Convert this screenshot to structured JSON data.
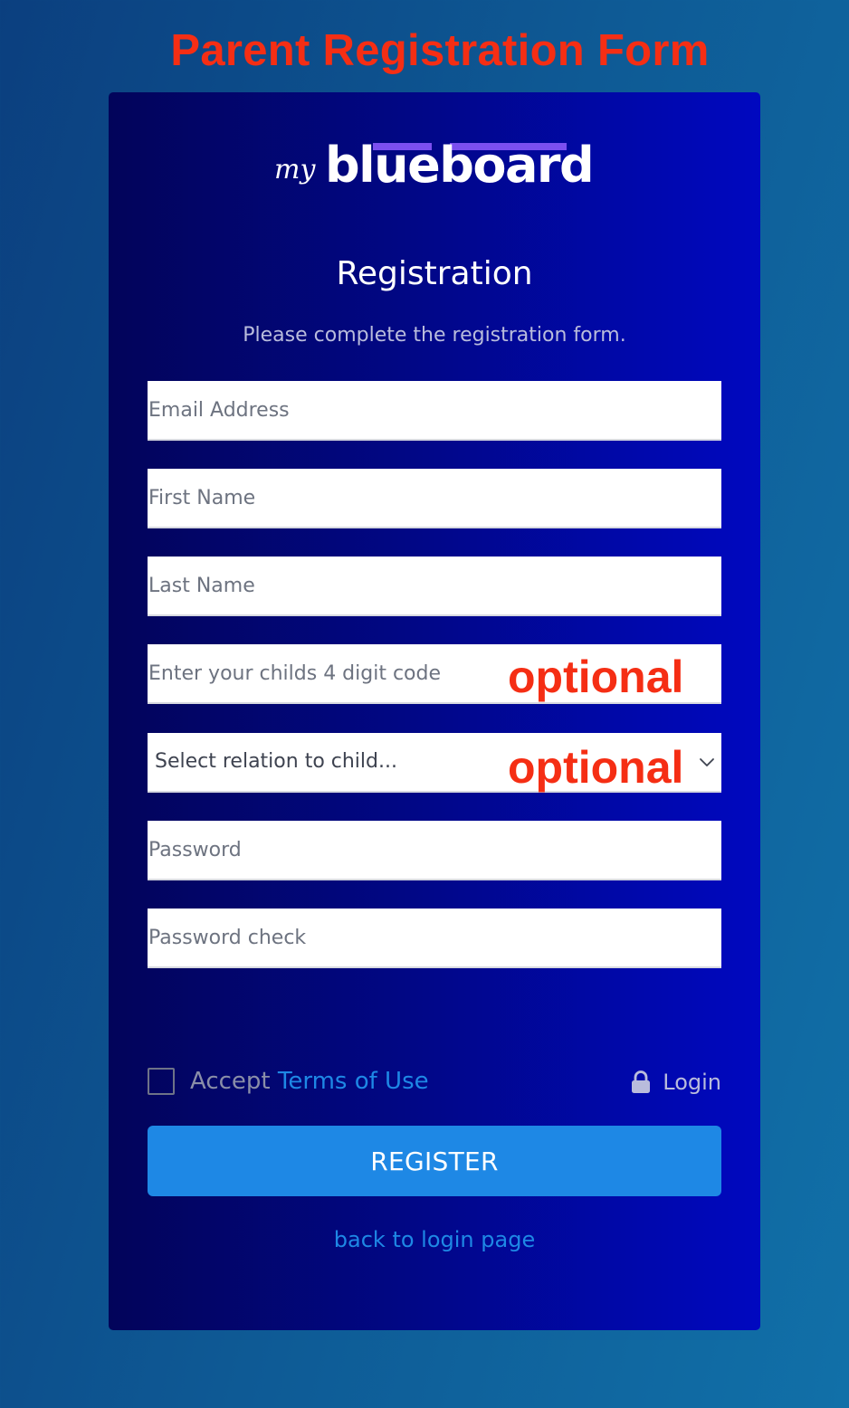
{
  "banner": {
    "text": "Parent Registration Form"
  },
  "logo": {
    "prefix": "my",
    "brand": "blueboard"
  },
  "form": {
    "title": "Registration",
    "subtitle": "Please complete the registration form.",
    "email_placeholder": "Email Address",
    "first_name_placeholder": "First Name",
    "last_name_placeholder": "Last Name",
    "child_code_placeholder": "Enter your childs 4 digit code",
    "relation_selected": "Select relation to child...",
    "password_placeholder": "Password",
    "password_check_placeholder": "Password check",
    "optional_note": "optional",
    "accept_label": "Accept",
    "terms_label": "Terms of Use",
    "login_label": "Login",
    "register_label": "REGISTER",
    "back_link": "back to login page"
  },
  "icons": {
    "lock": "lock-icon",
    "chevron": "chevron-down-icon",
    "checkbox": "checkbox-unchecked"
  },
  "colors": {
    "accent": "#1e88e5",
    "annotation": "#f52e14",
    "logo_bar": "#7b4ff0"
  }
}
